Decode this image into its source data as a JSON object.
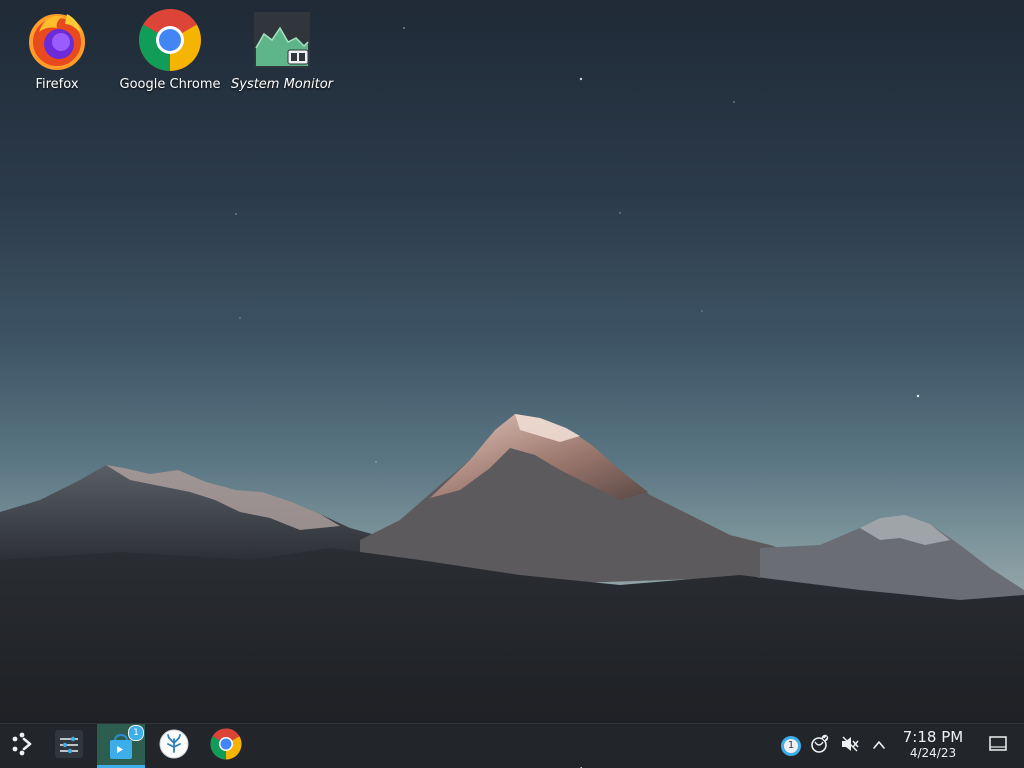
{
  "desktop": {
    "icons": [
      {
        "label": "Firefox",
        "icon": "firefox-icon"
      },
      {
        "label": "Google Chrome",
        "icon": "chrome-icon"
      },
      {
        "label": "System Monitor",
        "icon": "system-monitor-icon"
      }
    ]
  },
  "taskbar": {
    "items": [
      {
        "icon": "application-launcher-icon"
      },
      {
        "icon": "settings-sliders-icon"
      },
      {
        "icon": "discover-store-icon",
        "badge": "1"
      },
      {
        "icon": "steam-icon"
      },
      {
        "icon": "chrome-icon"
      }
    ],
    "tray": {
      "items": [
        {
          "icon": "updates-icon",
          "badge": "1"
        },
        {
          "icon": "network-icon"
        },
        {
          "icon": "volume-muted-icon"
        },
        {
          "icon": "chevron-up-icon"
        }
      ],
      "clock": {
        "time": "7:18 PM",
        "date": "4/24/23"
      },
      "show_desktop": {
        "icon": "show-desktop-icon"
      }
    }
  },
  "colors": {
    "taskbar_bg": "#22262b",
    "accent": "#3daee9",
    "active_task_bg": "#2c5d4f"
  }
}
